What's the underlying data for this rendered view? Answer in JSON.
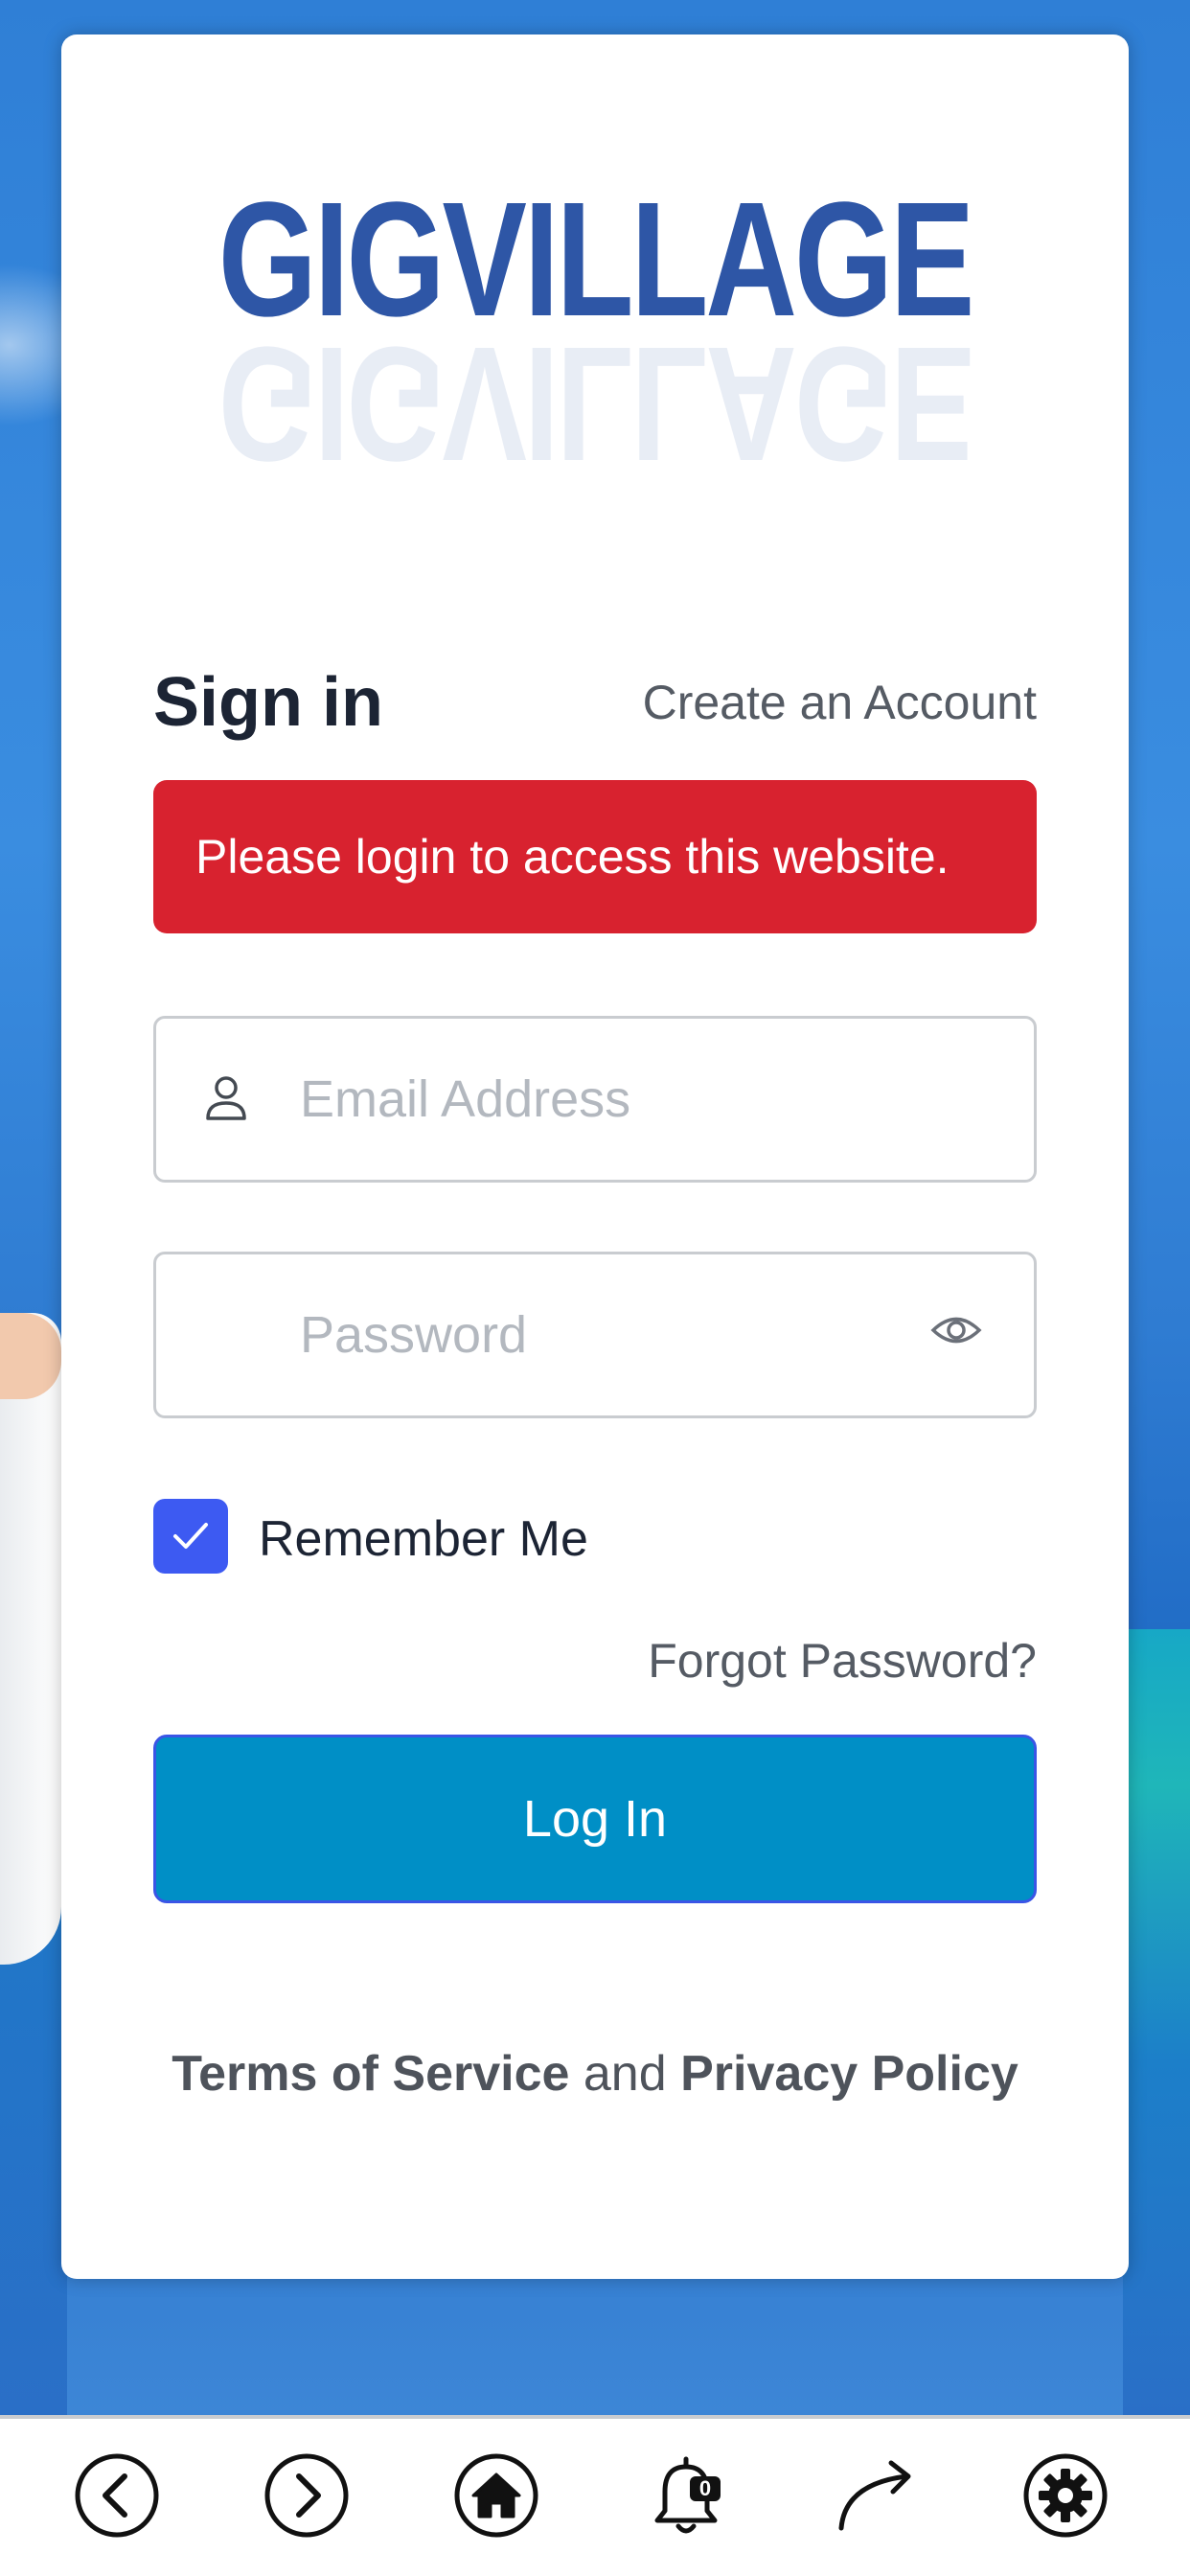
{
  "logo": {
    "text": "GIGVILLAGE"
  },
  "signin": {
    "title": "Sign in",
    "create_account": "Create an Account",
    "alert": "Please login to access this website."
  },
  "form": {
    "email_placeholder": "Email Address",
    "password_placeholder": "Password",
    "remember_label": "Remember Me",
    "remember_checked": true,
    "forgot_label": "Forgot Password?",
    "login_label": "Log In"
  },
  "legal": {
    "terms": "Terms of Service",
    "and": "and",
    "privacy": "Privacy Policy"
  },
  "bottom_nav": {
    "notification_count": "0",
    "items": [
      "back-icon",
      "forward-icon",
      "home-icon",
      "bell-icon",
      "share-icon",
      "settings-icon"
    ]
  },
  "colors": {
    "alert": "#d8222f",
    "primary_button": "#008fc6",
    "checkbox": "#3d5af2",
    "logo": "#2e56a6"
  }
}
